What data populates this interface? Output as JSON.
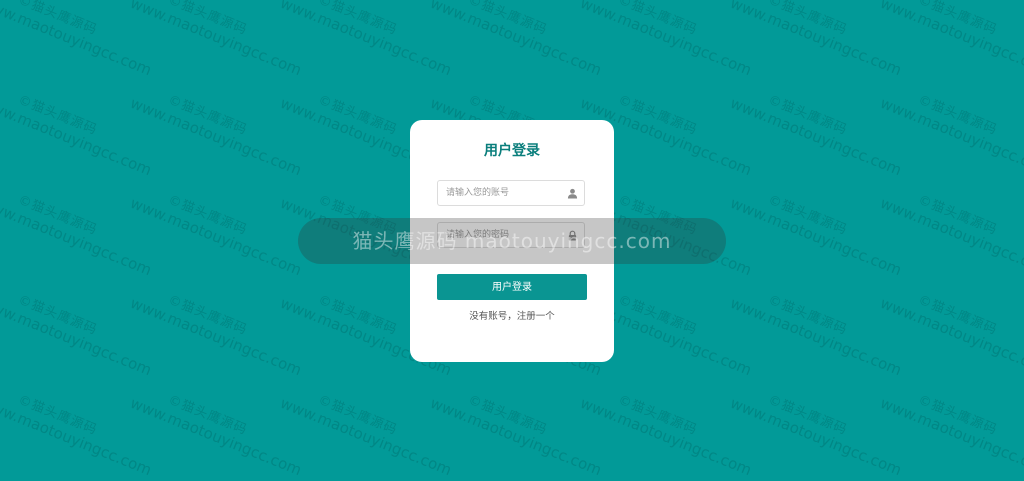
{
  "watermark": {
    "line1": "©猫头鹰源码",
    "line2": "www.maotouyingcc.com"
  },
  "banner": {
    "text": "猫头鹰源码 maotouyingcc.com"
  },
  "login": {
    "title": "用户登录",
    "username_placeholder": "请输入您的账号",
    "password_placeholder": "请输入您的密码",
    "login_button": "用户登录",
    "register_link": "没有账号，注册一个",
    "username_icon": "user-icon",
    "password_icon": "lock-icon"
  },
  "colors": {
    "background": "#029a98",
    "card": "#ffffff",
    "accent": "#0a9592",
    "title": "#0a7e7c"
  }
}
